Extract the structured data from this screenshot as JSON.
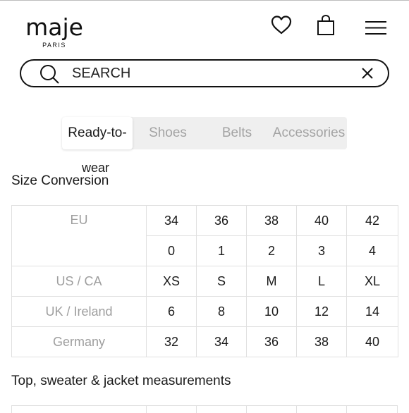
{
  "header": {
    "logo_text": "maje",
    "logo_subtext": "PARIS",
    "icons": [
      "heart-icon",
      "shopping-bag-icon",
      "hamburger-menu-icon"
    ]
  },
  "search": {
    "placeholder": "SEARCH",
    "value": "",
    "icons": [
      "search-icon",
      "close-icon"
    ]
  },
  "tabs": [
    {
      "label_line1": "Ready-to-",
      "label_line2": "wear",
      "active": true
    },
    {
      "label": "Shoes",
      "active": false
    },
    {
      "label": "Belts",
      "active": false
    },
    {
      "label": "Accessories",
      "active": false
    }
  ],
  "size_conversion": {
    "title": "Size Conversion",
    "rows": [
      {
        "label": "EU",
        "values": [
          "34",
          "36",
          "38",
          "40",
          "42"
        ]
      },
      {
        "label": "",
        "values": [
          "0",
          "1",
          "2",
          "3",
          "4"
        ]
      },
      {
        "label": "US / CA",
        "values": [
          "XS",
          "S",
          "M",
          "L",
          "XL"
        ]
      },
      {
        "label": "UK / Ireland",
        "values": [
          "6",
          "8",
          "10",
          "12",
          "14"
        ]
      },
      {
        "label": "Germany",
        "values": [
          "32",
          "34",
          "36",
          "38",
          "40"
        ]
      }
    ]
  },
  "measurements": {
    "title": "Top, sweater & jacket measurements"
  },
  "colors": {
    "text": "#1a1a1a",
    "muted_label": "#9e9e9e",
    "border": "#e0e0e0",
    "tab_bar_bg": "#efefef"
  }
}
